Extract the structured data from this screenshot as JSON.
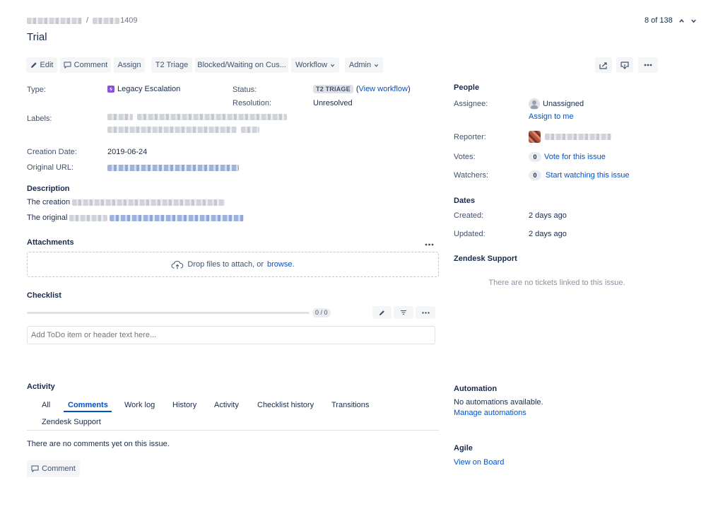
{
  "breadcrumb": {
    "separator": "/",
    "issue_suffix": "1409"
  },
  "pager": {
    "text": "8 of 138"
  },
  "issue": {
    "title": "Trial"
  },
  "toolbar": {
    "edit": "Edit",
    "comment": "Comment",
    "assign": "Assign",
    "t2_triage": "T2 Triage",
    "blocked": "Blocked/Waiting on Cus...",
    "workflow": "Workflow",
    "admin": "Admin"
  },
  "details": {
    "type_label": "Type:",
    "type_value": "Legacy Escalation",
    "status_label": "Status:",
    "status_value": "T2 TRIAGE",
    "view_workflow": "View workflow",
    "resolution_label": "Resolution:",
    "resolution_value": "Unresolved",
    "labels_label": "Labels:",
    "creation_label": "Creation Date:",
    "creation_value": "2019-06-24",
    "url_label": "Original URL:"
  },
  "description": {
    "title": "Description",
    "line1_prefix": "The creation",
    "line2_prefix": "The original"
  },
  "attachments": {
    "title": "Attachments",
    "drop_text": "Drop files to attach, or",
    "browse": "browse."
  },
  "checklist": {
    "title": "Checklist",
    "progress": "0 / 0",
    "placeholder": "Add ToDo item or header text here..."
  },
  "activity": {
    "title": "Activity",
    "tabs": [
      "All",
      "Comments",
      "Work log",
      "History",
      "Activity",
      "Checklist history",
      "Transitions",
      "Zendesk Support"
    ],
    "empty": "There are no comments yet on this issue.",
    "comment_button": "Comment"
  },
  "people": {
    "title": "People",
    "assignee_label": "Assignee:",
    "assignee_value": "Unassigned",
    "assign_to_me": "Assign to me",
    "reporter_label": "Reporter:",
    "votes_label": "Votes:",
    "votes_count": "0",
    "vote_link": "Vote for this issue",
    "watchers_label": "Watchers:",
    "watchers_count": "0",
    "watch_link": "Start watching this issue"
  },
  "dates": {
    "title": "Dates",
    "created_label": "Created:",
    "created_value": "2 days ago",
    "updated_label": "Updated:",
    "updated_value": "2 days ago"
  },
  "zendesk": {
    "title": "Zendesk Support",
    "empty": "There are no tickets linked to this issue."
  },
  "automation": {
    "title": "Automation",
    "text": "No automations available.",
    "manage": "Manage automations"
  },
  "agile": {
    "title": "Agile",
    "link": "View on Board"
  },
  "colors": {
    "link": "#0052cc",
    "text": "#172b4d",
    "button_bg": "#f4f5f7",
    "type_icon": "#904ee2"
  }
}
